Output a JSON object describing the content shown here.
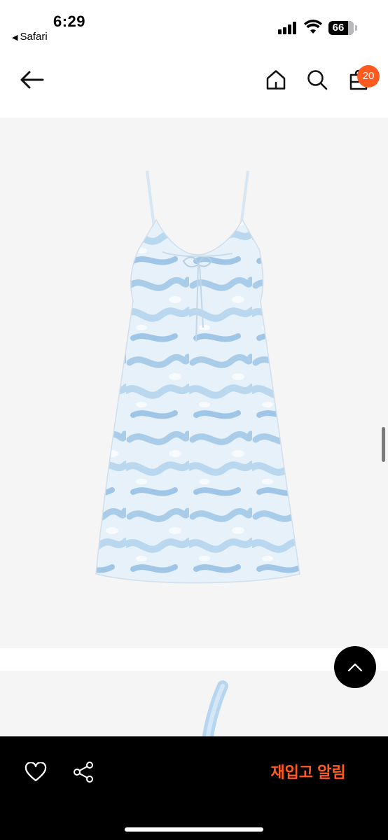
{
  "status_bar": {
    "time": "6:29",
    "back_app": "Safari",
    "battery": "66"
  },
  "nav": {
    "back_icon": "arrow-left-icon",
    "home_icon": "home-icon",
    "search_icon": "search-icon",
    "cart_icon": "shopping-bag-icon",
    "cart_count": "20"
  },
  "gallery": {
    "images": [
      {
        "subject": "light blue marbled print slip dress with front tie"
      },
      {
        "subject": "light blue strap of dress (partially visible)"
      }
    ]
  },
  "actions": {
    "scroll_top_icon": "chevron-up-icon",
    "wishlist_icon": "heart-icon",
    "share_icon": "share-icon",
    "restock_label": "재입고 알림"
  },
  "colors": {
    "accent": "#ff5a1f",
    "bottom_bar": "#000000",
    "gallery_bg": "#f5f5f5"
  }
}
